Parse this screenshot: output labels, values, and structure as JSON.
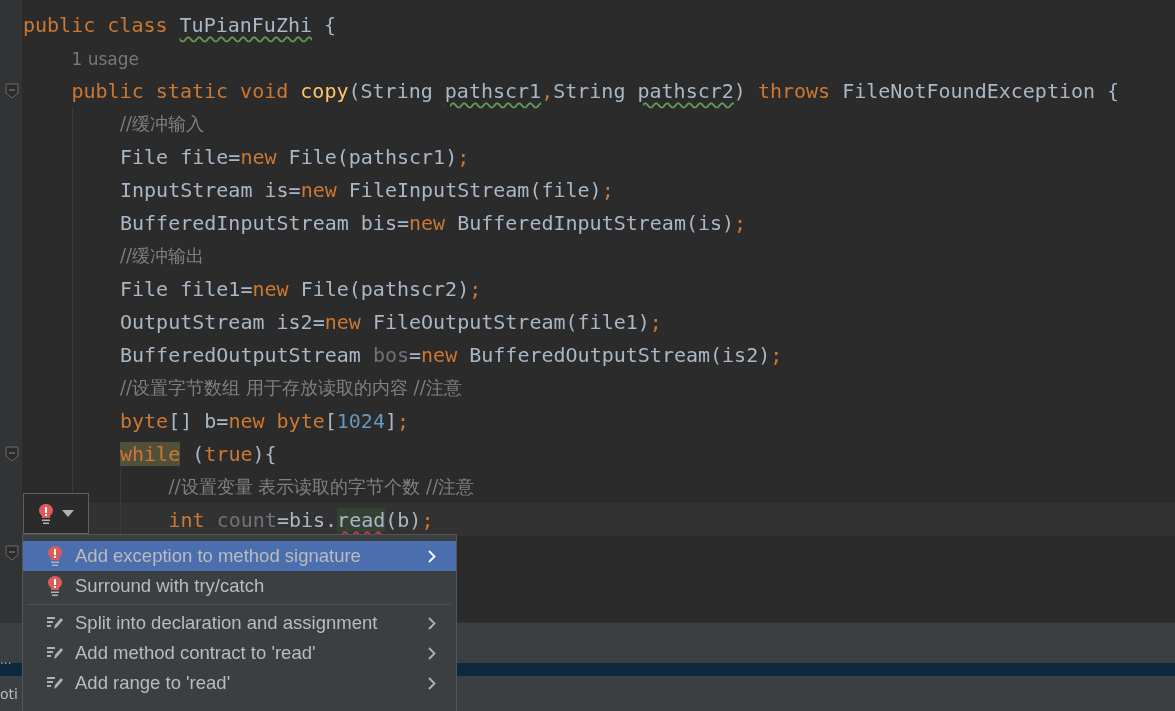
{
  "code": {
    "lines": [
      {
        "tokens": [
          {
            "t": "public ",
            "kind": "kw"
          },
          {
            "t": "class ",
            "kind": "kw"
          },
          {
            "t": "TuPianFuZhi",
            "kind": "plain",
            "warning": true
          },
          {
            "t": " {",
            "kind": "plain"
          }
        ],
        "fold": false,
        "current": false,
        "children": [
          {
            "tokens": [
              {
                "t": "1 usage",
                "kind": "hint"
              }
            ],
            "fold": false,
            "current": false
          },
          {
            "tokens": [
              {
                "t": "public ",
                "kind": "kw"
              },
              {
                "t": "static ",
                "kind": "kw"
              },
              {
                "t": "void ",
                "kind": "kw"
              },
              {
                "t": "copy",
                "kind": "fn"
              },
              {
                "t": "(String ",
                "kind": "plain"
              },
              {
                "t": "pathscr1",
                "kind": "plain",
                "warning": true
              },
              {
                "t": ",",
                "kind": "kw"
              },
              {
                "t": "String ",
                "kind": "plain"
              },
              {
                "t": "pathscr2",
                "kind": "plain",
                "warning": true
              },
              {
                "t": ") ",
                "kind": "plain"
              },
              {
                "t": "throws ",
                "kind": "kw"
              },
              {
                "t": "FileNotFoundException {",
                "kind": "plain"
              }
            ],
            "fold": true,
            "current": false,
            "children": [
              {
                "tokens": [
                  {
                    "t": "//缓冲输入",
                    "kind": "comment"
                  }
                ],
                "fold": false,
                "current": false
              },
              {
                "tokens": [
                  {
                    "t": "File file=",
                    "kind": "plain"
                  },
                  {
                    "t": "new ",
                    "kind": "kw"
                  },
                  {
                    "t": "File(pathscr1)",
                    "kind": "plain"
                  },
                  {
                    "t": ";",
                    "kind": "kw"
                  }
                ],
                "fold": false,
                "current": false
              },
              {
                "tokens": [
                  {
                    "t": "InputStream is=",
                    "kind": "plain"
                  },
                  {
                    "t": "new ",
                    "kind": "kw"
                  },
                  {
                    "t": "FileInputStream(file)",
                    "kind": "plain"
                  },
                  {
                    "t": ";",
                    "kind": "kw"
                  }
                ],
                "fold": false,
                "current": false
              },
              {
                "tokens": [
                  {
                    "t": "BufferedInputStream bis=",
                    "kind": "plain"
                  },
                  {
                    "t": "new ",
                    "kind": "kw"
                  },
                  {
                    "t": "BufferedInputStream(is)",
                    "kind": "plain"
                  },
                  {
                    "t": ";",
                    "kind": "kw"
                  }
                ],
                "fold": false,
                "current": false
              },
              {
                "tokens": [
                  {
                    "t": "//缓冲输出",
                    "kind": "comment"
                  }
                ],
                "fold": false,
                "current": false
              },
              {
                "tokens": [
                  {
                    "t": "File file1=",
                    "kind": "plain"
                  },
                  {
                    "t": "new ",
                    "kind": "kw"
                  },
                  {
                    "t": "File(pathscr2)",
                    "kind": "plain"
                  },
                  {
                    "t": ";",
                    "kind": "kw"
                  }
                ],
                "fold": false,
                "current": false
              },
              {
                "tokens": [
                  {
                    "t": "OutputStream is2=",
                    "kind": "plain"
                  },
                  {
                    "t": "new ",
                    "kind": "kw"
                  },
                  {
                    "t": "FileOutputStream(file1)",
                    "kind": "plain"
                  },
                  {
                    "t": ";",
                    "kind": "kw"
                  }
                ],
                "fold": false,
                "current": false
              },
              {
                "tokens": [
                  {
                    "t": "BufferedOutputStream ",
                    "kind": "plain"
                  },
                  {
                    "t": "bos",
                    "kind": "unused"
                  },
                  {
                    "t": "=",
                    "kind": "plain"
                  },
                  {
                    "t": "new ",
                    "kind": "kw"
                  },
                  {
                    "t": "BufferedOutputStream(is2)",
                    "kind": "plain"
                  },
                  {
                    "t": ";",
                    "kind": "kw"
                  }
                ],
                "fold": false,
                "current": false
              },
              {
                "tokens": [
                  {
                    "t": "//设置字节数组 用于存放读取的内容 //注意",
                    "kind": "comment"
                  }
                ],
                "fold": false,
                "current": false
              },
              {
                "tokens": [
                  {
                    "t": "byte",
                    "kind": "kw"
                  },
                  {
                    "t": "[] b=",
                    "kind": "plain"
                  },
                  {
                    "t": "new ",
                    "kind": "kw"
                  },
                  {
                    "t": "byte",
                    "kind": "kw"
                  },
                  {
                    "t": "[",
                    "kind": "plain"
                  },
                  {
                    "t": "1024",
                    "kind": "num"
                  },
                  {
                    "t": "]",
                    "kind": "plain"
                  },
                  {
                    "t": ";",
                    "kind": "kw"
                  }
                ],
                "fold": false,
                "current": false
              },
              {
                "tokens": [
                  {
                    "t": "while",
                    "kind": "kw",
                    "highlight": true
                  },
                  {
                    "t": " (",
                    "kind": "plain"
                  },
                  {
                    "t": "true",
                    "kind": "kw"
                  },
                  {
                    "t": "){",
                    "kind": "plain"
                  }
                ],
                "fold": true,
                "current": false,
                "children": [
                  {
                    "tokens": [
                      {
                        "t": "//设置变量 表示读取的字节个数 //注意",
                        "kind": "comment"
                      }
                    ],
                    "fold": false,
                    "current": false
                  },
                  {
                    "tokens": [
                      {
                        "t": "int ",
                        "kind": "kw"
                      },
                      {
                        "t": "count",
                        "kind": "unused"
                      },
                      {
                        "t": "=bis.",
                        "kind": "plain"
                      },
                      {
                        "t": "read",
                        "kind": "plain",
                        "error": true,
                        "highlight": true
                      },
                      {
                        "t": "(b)",
                        "kind": "plain"
                      },
                      {
                        "t": ";",
                        "kind": "kw"
                      }
                    ],
                    "fold": false,
                    "current": true
                  }
                ]
              },
              {
                "fold": true,
                "current": false
              }
            ]
          }
        ]
      }
    ]
  },
  "intention_button": {
    "kind": "error"
  },
  "popup_menu": {
    "items": [
      {
        "label": "Add exception to method signature",
        "kind": "error",
        "selected": true,
        "submenu": true,
        "separator_after": false
      },
      {
        "label": "Surround with try/catch",
        "kind": "error",
        "selected": false,
        "submenu": false,
        "separator_after": true
      },
      {
        "label": "Split into declaration and assignment",
        "kind": "intention",
        "selected": false,
        "submenu": true,
        "separator_after": false
      },
      {
        "label": "Add method contract to 'read'",
        "kind": "intention",
        "selected": false,
        "submenu": true,
        "separator_after": false
      },
      {
        "label": "Add range to 'read'",
        "kind": "intention",
        "selected": false,
        "submenu": true,
        "separator_after": false
      }
    ]
  },
  "tool_panel": {
    "text": "..."
  },
  "status_bar": {
    "text": "oti"
  }
}
